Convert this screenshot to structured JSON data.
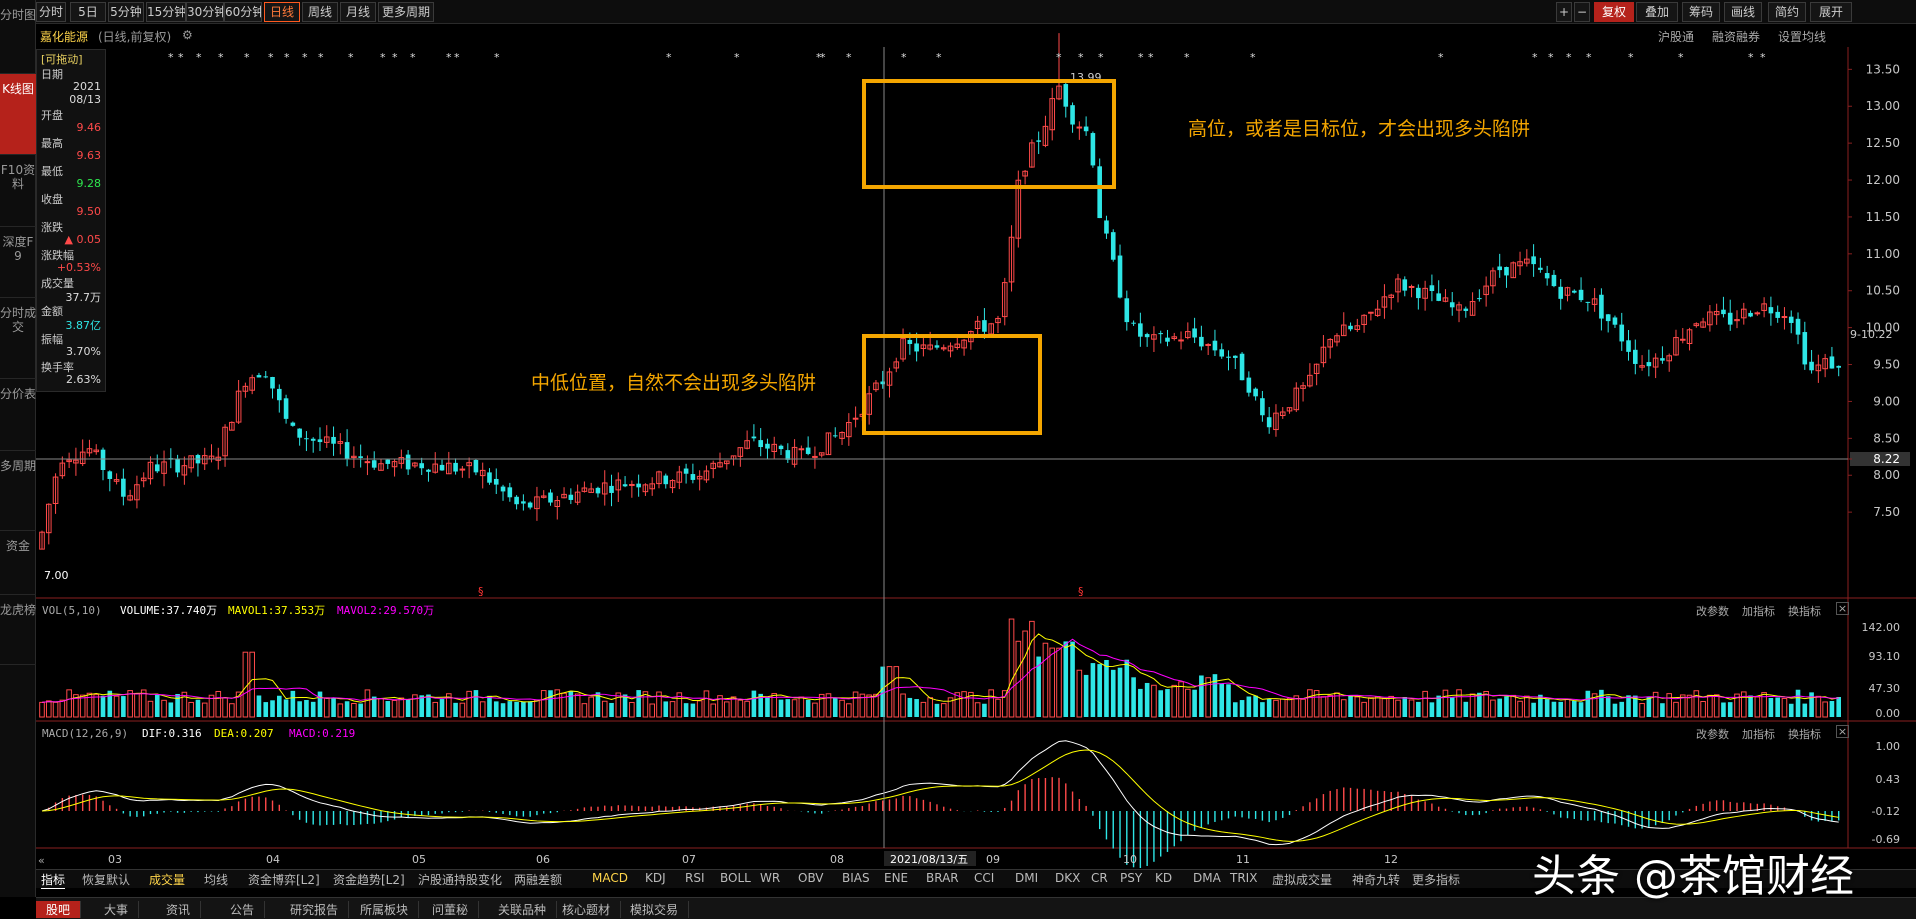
{
  "topbar": {
    "tabs": [
      "分时",
      "5日",
      "5分钟",
      "15分钟",
      "30分钟",
      "60分钟",
      "日线",
      "周线",
      "月线",
      "更多周期"
    ],
    "active": "日线",
    "right": [
      "复权",
      "叠加",
      "筹码",
      "画线",
      "简约",
      "展开"
    ]
  },
  "leftnav": [
    "分时图",
    "K线图",
    "F10资料",
    "深度F9",
    "分时成交",
    "分价表",
    "多周期",
    "资金",
    "龙虎榜"
  ],
  "stock": {
    "name": "嘉化能源",
    "mode": "(日线,前复权)",
    "links": [
      "沪股通",
      "融资融券",
      "设置均线"
    ]
  },
  "infobox": {
    "drag": "[可拖动]",
    "date_label": "日期",
    "year": "2021",
    "date": "08/13",
    "open_label": "开盘",
    "open": "9.46",
    "high_label": "最高",
    "high": "9.63",
    "low_label": "最低",
    "low": "9.28",
    "close_label": "收盘",
    "close": "9.50",
    "change_label": "涨跌",
    "change": "▲ 0.05",
    "pct_label": "涨跌幅",
    "pct": "+0.53%",
    "vol_label": "成交量",
    "vol": "37.7万",
    "amt_label": "金额",
    "amt": "3.87亿",
    "amp_label": "振幅",
    "amp": "3.70%",
    "turn_label": "换手率",
    "turn": "2.63%"
  },
  "annotations": {
    "low": "中低位置，自然不会出现多头陷阱",
    "high": "高位，或者是目标位，才会出现多头陷阱"
  },
  "price_axis": [
    "13.50",
    "13.00",
    "12.50",
    "12.00",
    "11.50",
    "11.00",
    "10.50",
    "10.00",
    "9.50",
    "9.00",
    "8.50",
    "8.22",
    "8.00",
    "7.50"
  ],
  "price_marks": {
    "max": "13.99",
    "min": "7.00",
    "right_tag": "9-10.22",
    "cross_price": "8.22"
  },
  "months": [
    "03",
    "04",
    "05",
    "06",
    "07",
    "08",
    "09",
    "10",
    "11",
    "12"
  ],
  "cursor_date": "2021/08/13/五",
  "vol_indicator": {
    "name": "VOL(5,10)",
    "volume": "VOLUME:37.740万",
    "ma1": "MAVOL1:37.353万",
    "ma2": "MAVOL2:29.570万",
    "axis": [
      "142.00",
      "93.10",
      "47.30",
      "0.00"
    ]
  },
  "macd_indicator": {
    "name": "MACD(12,26,9)",
    "dif": "DIF:0.316",
    "dea": "DEA:0.207",
    "macd": "MACD:0.219",
    "axis": [
      "1.00",
      "0.43",
      "-0.12",
      "-0.69"
    ]
  },
  "indicator_tools": [
    "改参数",
    "加指标",
    "换指标"
  ],
  "bottom_tabs": [
    "指标",
    "恢复默认",
    "成交量",
    "均线",
    "资金博弈[L2]",
    "资金趋势[L2]",
    "沪股通持股变化",
    "两融差额",
    "MACD",
    "KDJ",
    "RSI",
    "BOLL",
    "WR",
    "OBV",
    "BIAS",
    "ENE",
    "BRAR",
    "CCI",
    "DMI",
    "DKX",
    "CR",
    "PSY",
    "KD",
    "DMA",
    "TRIX",
    "虚拟成交量",
    "神奇九转",
    "更多指标"
  ],
  "bottom_bar": [
    "股吧",
    "大事",
    "资讯",
    "公告",
    "研究报告",
    "所属板块",
    "问董秘",
    "关联品种",
    "核心题材",
    "模拟交易"
  ],
  "watermark": "头条 @茶馆财经",
  "colors": {
    "up": "#ff4a4a",
    "down": "#2ee6e6",
    "ma_white": "#ffffff",
    "ma_yellow": "#ffff00",
    "ma_magenta": "#ff00ff",
    "annotation": "#f4a600"
  }
}
